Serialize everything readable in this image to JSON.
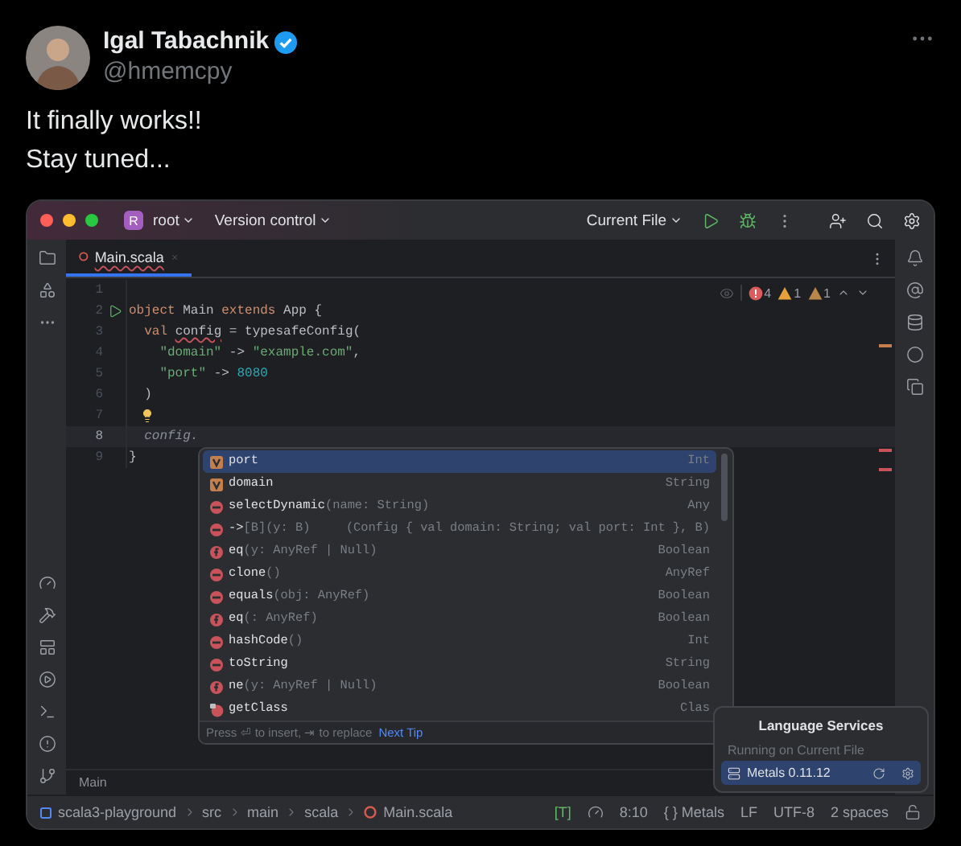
{
  "tweet": {
    "author": "Igal Tabachnik",
    "verified": true,
    "handle": "@hmemcpy",
    "lines": [
      "It finally works!!",
      "Stay tuned..."
    ]
  },
  "ide": {
    "title_bar": {
      "project_badge": "R",
      "project": "root",
      "vcs": "Version control",
      "run_config": "Current File"
    },
    "tabs": [
      {
        "label": "Main.scala",
        "selected": true
      }
    ],
    "inspections": [
      {
        "kind": "error",
        "count": "4"
      },
      {
        "kind": "warning",
        "count": "1"
      },
      {
        "kind": "weak",
        "count": "1"
      }
    ],
    "code_lines": [
      {
        "number": "1",
        "current": false,
        "runnable": false,
        "bulb": false
      },
      {
        "number": "2",
        "current": false,
        "runnable": true,
        "bulb": false,
        "tokens": [
          {
            "text": "object",
            "kind": "keyword"
          },
          {
            "text": " Main ",
            "kind": "plain"
          },
          {
            "text": "extends",
            "kind": "keyword"
          },
          {
            "text": " App {",
            "kind": "plain"
          }
        ]
      },
      {
        "number": "3",
        "current": false,
        "runnable": false,
        "bulb": false,
        "tokens": [
          {
            "text": "  val ",
            "kind": "keyword"
          },
          {
            "text": "config",
            "kind": "warning"
          },
          {
            "text": " = typesafeConfig(",
            "kind": "plain"
          }
        ]
      },
      {
        "number": "4",
        "current": false,
        "runnable": false,
        "bulb": false,
        "tokens": [
          {
            "text": "    \"domain\"",
            "kind": "string"
          },
          {
            "text": " -> ",
            "kind": "plain"
          },
          {
            "text": "\"example.com\"",
            "kind": "string"
          },
          {
            "text": ",",
            "kind": "plain"
          }
        ]
      },
      {
        "number": "5",
        "current": false,
        "runnable": false,
        "bulb": false,
        "tokens": [
          {
            "text": "    \"port\"",
            "kind": "string"
          },
          {
            "text": " -> ",
            "kind": "plain"
          },
          {
            "text": "8080",
            "kind": "number"
          }
        ]
      },
      {
        "number": "6",
        "current": false,
        "runnable": false,
        "bulb": false,
        "tokens": [
          {
            "text": "  )",
            "kind": "plain"
          }
        ]
      },
      {
        "number": "7",
        "current": false,
        "runnable": false,
        "bulb": true
      },
      {
        "number": "8",
        "current": true,
        "runnable": false,
        "bulb": false,
        "tokens": [
          {
            "text": "  config.",
            "kind": "hint"
          }
        ]
      },
      {
        "number": "9",
        "current": false,
        "runnable": false,
        "bulb": false,
        "tokens": [
          {
            "text": "}",
            "kind": "plain"
          }
        ]
      }
    ],
    "completion": {
      "items": [
        {
          "name": "port",
          "type": "Int",
          "kind": "value",
          "selected": true
        },
        {
          "name": "domain",
          "type": "String",
          "kind": "value",
          "selected": false
        },
        {
          "name": "selectDynamic",
          "signature": "(name: String)",
          "type": "Any",
          "kind": "method",
          "selected": false
        },
        {
          "name": "->",
          "signature": "[B](y: B)",
          "type": "(Config { val domain: String; val port: Int }, B)",
          "kind": "method",
          "selected": false
        },
        {
          "name": "eq",
          "signature": "(y: AnyRef | Null)",
          "type": "Boolean",
          "kind": "function",
          "selected": false
        },
        {
          "name": "clone",
          "signature": "()",
          "type": "AnyRef",
          "kind": "method",
          "selected": false
        },
        {
          "name": "equals",
          "signature": "(obj: AnyRef)",
          "type": "Boolean",
          "kind": "method",
          "selected": false
        },
        {
          "name": "eq",
          "signature": "(: AnyRef)",
          "type": "Boolean",
          "kind": "function",
          "selected": false
        },
        {
          "name": "hashCode",
          "signature": "()",
          "type": "Int",
          "kind": "method",
          "selected": false
        },
        {
          "name": "toString",
          "type": "String",
          "kind": "method",
          "selected": false
        },
        {
          "name": "ne",
          "signature": "(y: AnyRef | Null)",
          "type": "Boolean",
          "kind": "function",
          "selected": false
        },
        {
          "name": "getClass",
          "type": "Clas",
          "kind": "class",
          "selected": false
        }
      ],
      "hint": "Press ⏎ to insert, ⇥ to replace",
      "tip_link": "Next Tip"
    },
    "editor_breadcrumb": "Main",
    "language_services": {
      "title": "Language Services",
      "subtitle": "Running on Current File",
      "servers": [
        {
          "name": "Metals 0.11.12",
          "selected": true
        }
      ]
    },
    "status_bar": {
      "path": [
        "scala3-playground",
        "src",
        "main",
        "scala",
        "Main.scala"
      ],
      "mode": "[T]",
      "position": "8:10",
      "language_server": "{ } Metals",
      "line_ending": "LF",
      "encoding": "UTF-8",
      "indent": "2 spaces"
    }
  }
}
